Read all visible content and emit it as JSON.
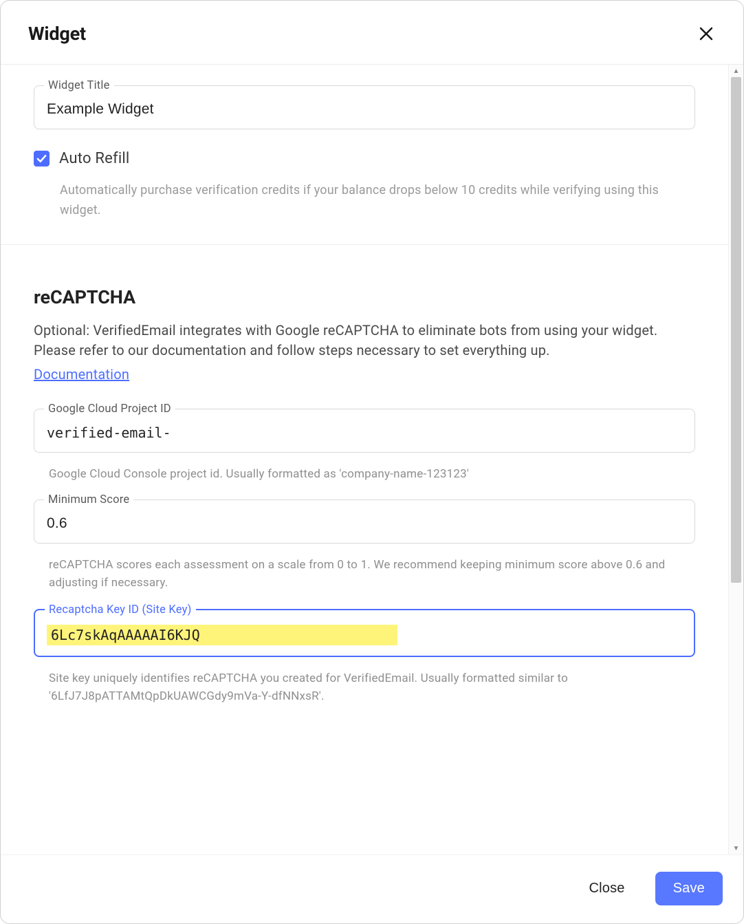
{
  "modal": {
    "title": "Widget"
  },
  "form": {
    "widget_title": {
      "label": "Widget Title",
      "value": "Example Widget"
    },
    "auto_refill": {
      "label": "Auto Refill",
      "helper": "Automatically purchase verification credits if your balance drops below 10 credits while verifying using this widget."
    }
  },
  "recaptcha": {
    "heading": "reCAPTCHA",
    "description": "Optional: VerifiedEmail integrates with Google reCAPTCHA to eliminate bots from using your widget. Please refer to our documentation and follow steps necessary to set everything up.",
    "doc_link_label": "Documentation",
    "project_id": {
      "label": "Google Cloud Project ID",
      "value": "verified-email-",
      "helper": "Google Cloud Console project id. Usually formatted as 'company-name-123123'"
    },
    "min_score": {
      "label": "Minimum Score",
      "value": "0.6",
      "helper": "reCAPTCHA scores each assessment on a scale from 0 to 1. We recommend keeping minimum score above 0.6 and adjusting if necessary."
    },
    "site_key": {
      "label": "Recaptcha Key ID (Site Key)",
      "value": "6Lc7skAqAAAAAI6KJQ",
      "helper": "Site key uniquely identifies reCAPTCHA you created for VerifiedEmail. Usually formatted similar to '6LfJ7J8pATTAMtQpDkUAWCGdy9mVa-Y-dfNNxsR'."
    }
  },
  "footer": {
    "close_label": "Close",
    "save_label": "Save"
  }
}
